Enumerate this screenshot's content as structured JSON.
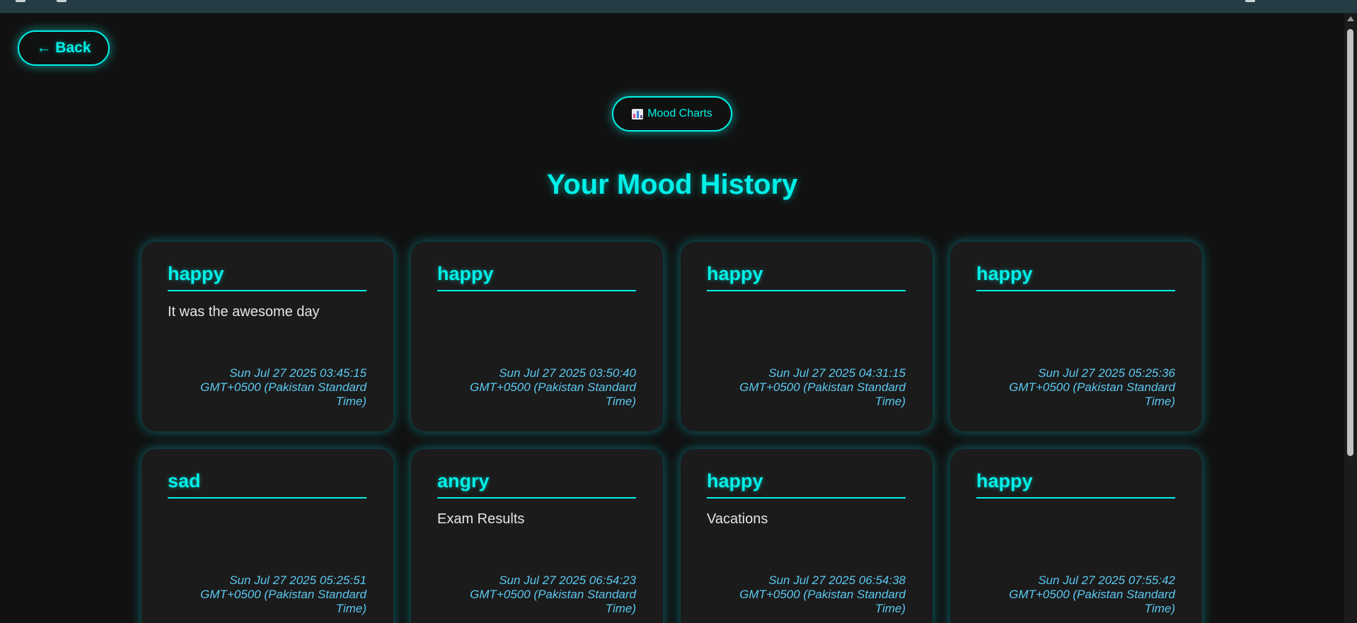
{
  "nav": {
    "back_label": "← Back",
    "mood_charts_label": "Mood Charts",
    "mood_charts_icon": "bar-chart-icon"
  },
  "page": {
    "title": "Your Mood History"
  },
  "colors": {
    "accent": "#00f0e8",
    "background": "#111111",
    "card": "#1b1b1b",
    "date_text": "#5bc8f0"
  },
  "entries": [
    {
      "mood": "happy",
      "note": "It was the awesome day",
      "date": "Sun Jul 27 2025 03:45:15 GMT+0500 (Pakistan Standard Time)"
    },
    {
      "mood": "happy",
      "note": "",
      "date": "Sun Jul 27 2025 03:50:40 GMT+0500 (Pakistan Standard Time)"
    },
    {
      "mood": "happy",
      "note": "",
      "date": "Sun Jul 27 2025 04:31:15 GMT+0500 (Pakistan Standard Time)"
    },
    {
      "mood": "happy",
      "note": "",
      "date": "Sun Jul 27 2025 05:25:36 GMT+0500 (Pakistan Standard Time)"
    },
    {
      "mood": "sad",
      "note": "",
      "date": "Sun Jul 27 2025 05:25:51 GMT+0500 (Pakistan Standard Time)"
    },
    {
      "mood": "angry",
      "note": "Exam Results",
      "date": "Sun Jul 27 2025 06:54:23 GMT+0500 (Pakistan Standard Time)"
    },
    {
      "mood": "happy",
      "note": "Vacations",
      "date": "Sun Jul 27 2025 06:54:38 GMT+0500 (Pakistan Standard Time)"
    },
    {
      "mood": "happy",
      "note": "",
      "date": "Sun Jul 27 2025 07:55:42 GMT+0500 (Pakistan Standard Time)"
    }
  ]
}
